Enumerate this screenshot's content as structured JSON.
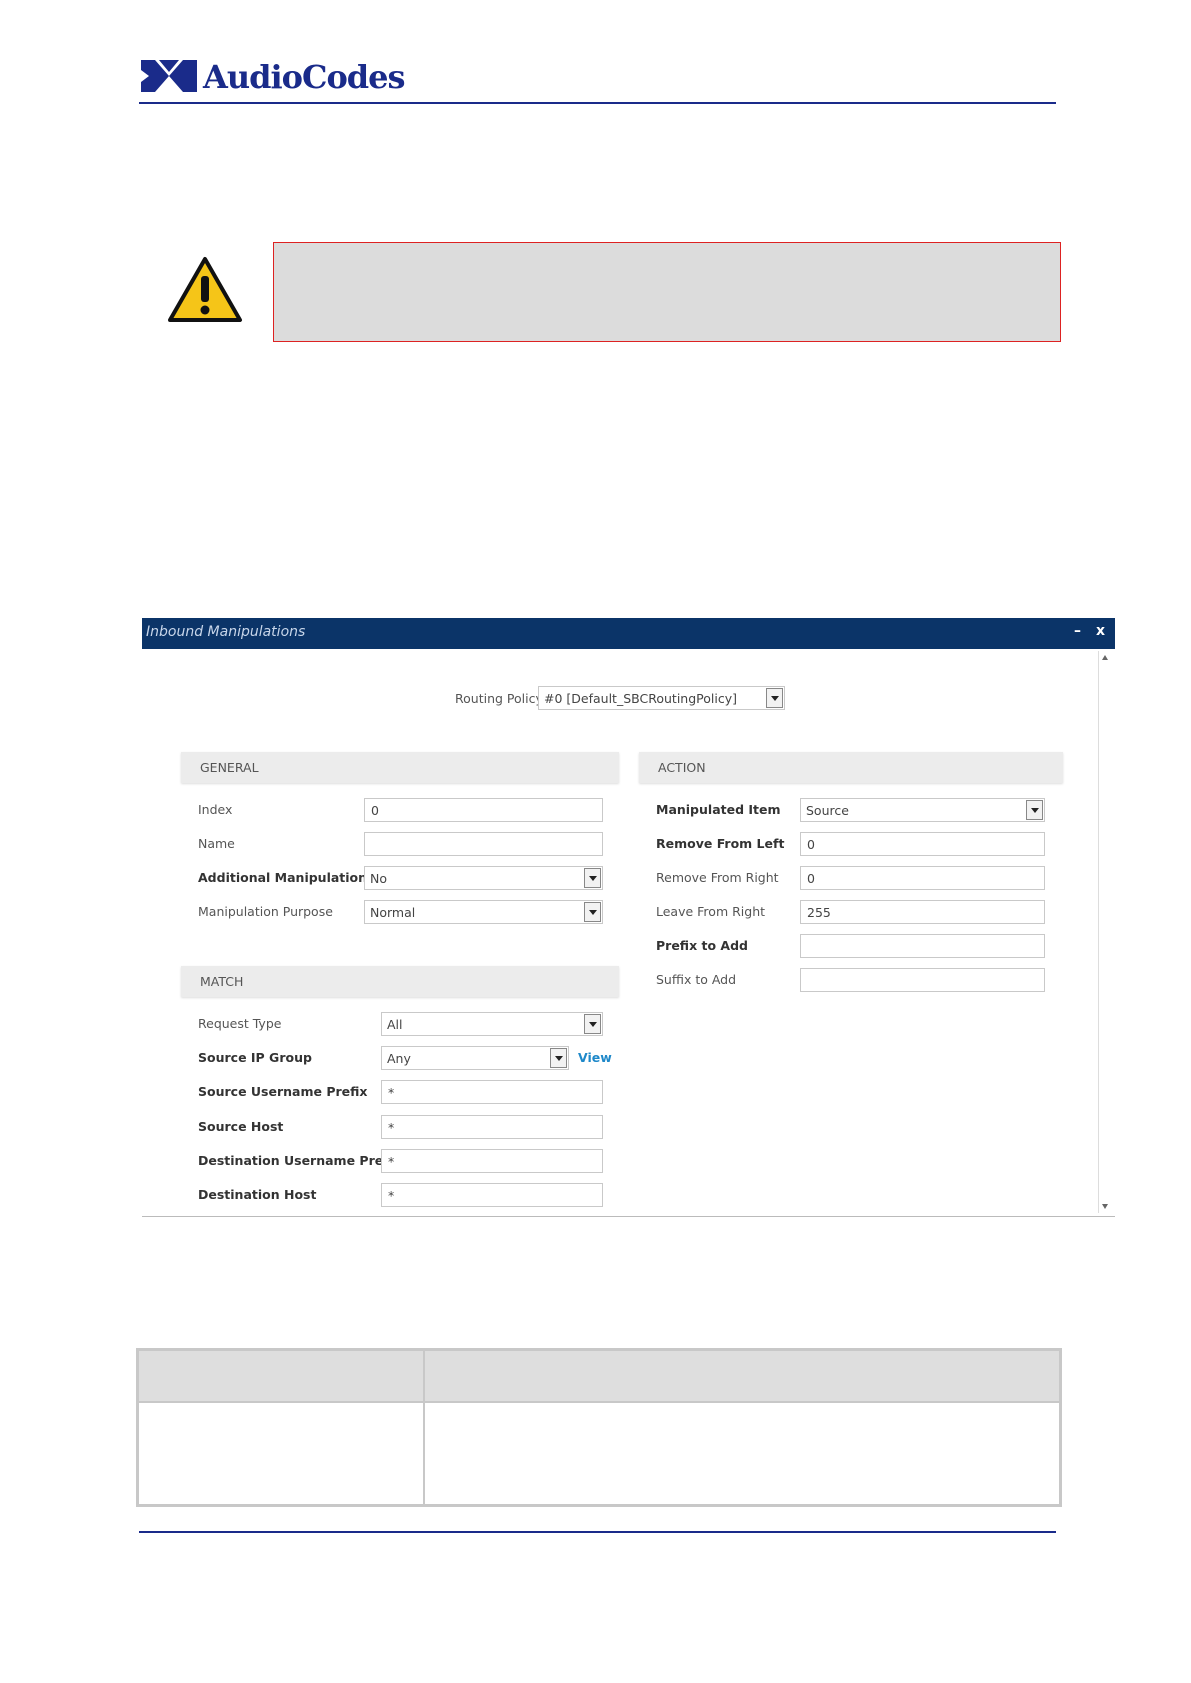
{
  "brand": {
    "name": "AudioCodes",
    "color": "#1a2b8a"
  },
  "warning": {
    "icon": "warning-triangle-icon",
    "border_color": "#dd2222"
  },
  "dialog": {
    "title": "Inbound Manipulations",
    "minimize_label": "–",
    "close_label": "x",
    "routing_policy": {
      "label": "Routing Policy",
      "value": "#0 [Default_SBCRoutingPolicy]"
    },
    "general": {
      "heading": "GENERAL",
      "index": {
        "label": "Index",
        "value": "0"
      },
      "name": {
        "label": "Name",
        "value": ""
      },
      "additional_manipulation": {
        "label": "Additional Manipulation",
        "value": "No"
      },
      "manipulation_purpose": {
        "label": "Manipulation Purpose",
        "value": "Normal"
      }
    },
    "match": {
      "heading": "MATCH",
      "request_type": {
        "label": "Request Type",
        "value": "All"
      },
      "source_ip_group": {
        "label": "Source IP Group",
        "value": "Any",
        "link": "View"
      },
      "source_username_prefix": {
        "label": "Source Username Prefix",
        "value": "*"
      },
      "source_host": {
        "label": "Source Host",
        "value": "*"
      },
      "destination_username_prefix": {
        "label": "Destination Username Prefix",
        "value": "*"
      },
      "destination_host": {
        "label": "Destination Host",
        "value": "*"
      }
    },
    "action": {
      "heading": "ACTION",
      "manipulated_item": {
        "label": "Manipulated Item",
        "value": "Source"
      },
      "remove_from_left": {
        "label": "Remove From Left",
        "value": "0"
      },
      "remove_from_right": {
        "label": "Remove From Right",
        "value": "0"
      },
      "leave_from_right": {
        "label": "Leave From Right",
        "value": "255"
      },
      "prefix_to_add": {
        "label": "Prefix to Add",
        "value": ""
      },
      "suffix_to_add": {
        "label": "Suffix to Add",
        "value": ""
      }
    }
  }
}
